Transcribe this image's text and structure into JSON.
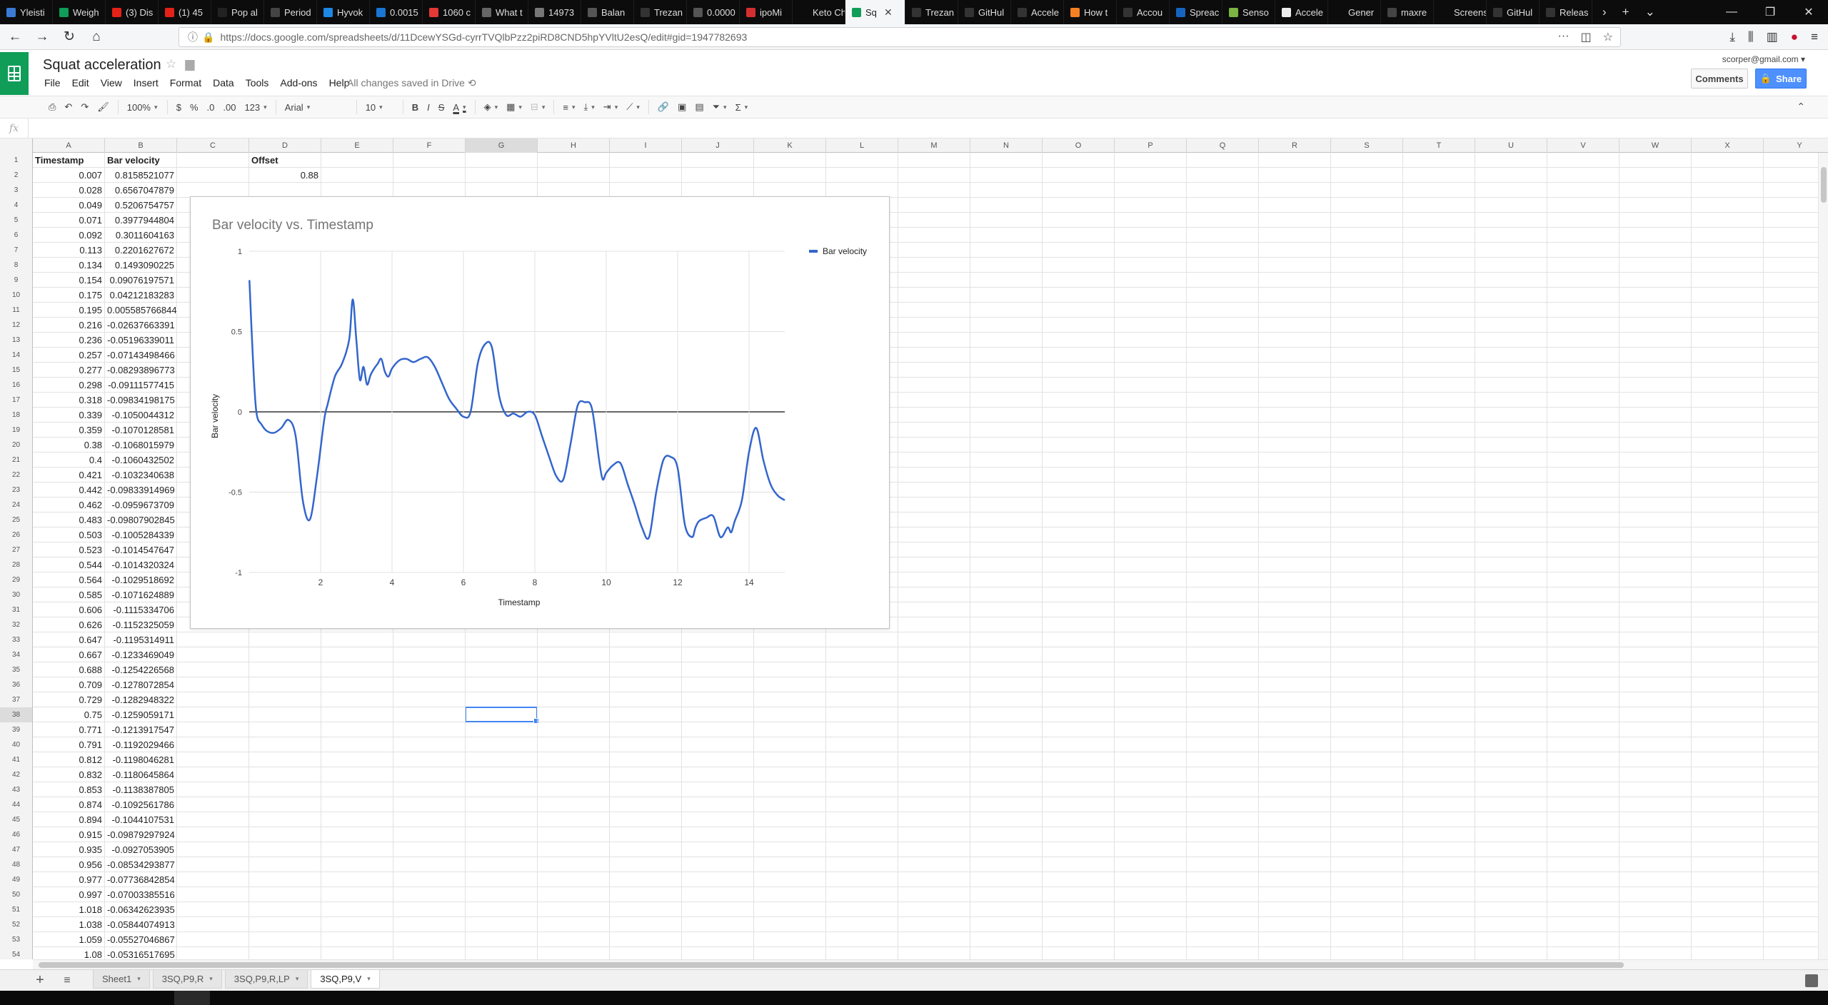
{
  "browser": {
    "tabs": [
      {
        "label": "Yleisti",
        "color": "#3a7bd5"
      },
      {
        "label": "Weigh",
        "color": "#0f9d58"
      },
      {
        "label": "(3) Dis",
        "color": "#e62117"
      },
      {
        "label": "(1) 45",
        "color": "#e62117"
      },
      {
        "label": "Pop al",
        "color": "#222222"
      },
      {
        "label": "Period",
        "color": "#444444"
      },
      {
        "label": "Hyvok",
        "color": "#1e88e5"
      },
      {
        "label": "0.0015",
        "color": "#1976d2"
      },
      {
        "label": "1060 c",
        "color": "#e53935"
      },
      {
        "label": "What t",
        "color": "#666666"
      },
      {
        "label": "14973",
        "color": "#777777"
      },
      {
        "label": "Balan",
        "color": "#555555"
      },
      {
        "label": "Trezan",
        "color": "#333333"
      },
      {
        "label": "0.0000",
        "color": "#555555"
      },
      {
        "label": "ipoMi",
        "color": "#d32f2f"
      },
      {
        "label": "Keto Choic",
        "color": "#0c0c0d"
      },
      {
        "label": "Sq",
        "color": "#0f9d58",
        "active": true
      },
      {
        "label": "Trezan",
        "color": "#333333"
      },
      {
        "label": "GitHul",
        "color": "#333333"
      },
      {
        "label": "Accele",
        "color": "#333333"
      },
      {
        "label": "How t",
        "color": "#f48024"
      },
      {
        "label": "Accou",
        "color": "#333333"
      },
      {
        "label": "Spreac",
        "color": "#1565c0"
      },
      {
        "label": "Senso",
        "color": "#7cb342"
      },
      {
        "label": "Accele",
        "color": "#eeeeee"
      },
      {
        "label": "Gener",
        "color": "#0c0c0d"
      },
      {
        "label": "maxre",
        "color": "#444444"
      },
      {
        "label": "Screenshot",
        "color": "#0c0c0d"
      },
      {
        "label": "GitHul",
        "color": "#333333"
      },
      {
        "label": "Releas",
        "color": "#333333"
      }
    ],
    "url": "https://docs.google.com/spreadsheets/d/11DcewYSGd-cyrrTVQlbPzz2piRD8CND5hpYVltU2esQ/edit#gid=1947782693"
  },
  "app": {
    "title": "Squat acceleration",
    "menus": [
      "File",
      "Edit",
      "View",
      "Insert",
      "Format",
      "Data",
      "Tools",
      "Add-ons",
      "Help"
    ],
    "save_status": "All changes saved in Drive",
    "user_email": "scorper@gmail.com",
    "comments_label": "Comments",
    "share_label": "Share"
  },
  "toolbar": {
    "zoom": "100%",
    "currency": "$",
    "percent": "%",
    "dec_less": ".0",
    "dec_more": ".00",
    "more_formats": "123",
    "font": "Arial",
    "font_size": "10",
    "bold": "B",
    "italic": "I",
    "strike": "S",
    "textcolor": "A",
    "sum": "Σ"
  },
  "formula": {
    "fx": "fx",
    "value": ""
  },
  "columns": [
    "A",
    "B",
    "C",
    "D",
    "E",
    "F",
    "G",
    "H",
    "I",
    "J",
    "K",
    "L",
    "M",
    "N",
    "O",
    "P",
    "Q",
    "R",
    "S",
    "T",
    "U",
    "V",
    "W",
    "X",
    "Y"
  ],
  "selected_column": "G",
  "selected_row": 38,
  "cells": {
    "a1": "Timestamp",
    "b1": "Bar velocity",
    "d1": "Offset",
    "d2": "0.88"
  },
  "data_rows": [
    [
      "0.007",
      "0.8158521077"
    ],
    [
      "0.028",
      "0.6567047879"
    ],
    [
      "0.049",
      "0.5206754757"
    ],
    [
      "0.071",
      "0.3977944804"
    ],
    [
      "0.092",
      "0.3011604163"
    ],
    [
      "0.113",
      "0.2201627672"
    ],
    [
      "0.134",
      "0.1493090225"
    ],
    [
      "0.154",
      "0.09076197571"
    ],
    [
      "0.175",
      "0.04212183283"
    ],
    [
      "0.195",
      "0.005585766844"
    ],
    [
      "0.216",
      "-0.02637663391"
    ],
    [
      "0.236",
      "-0.05196339011"
    ],
    [
      "0.257",
      "-0.07143498466"
    ],
    [
      "0.277",
      "-0.08293896773"
    ],
    [
      "0.298",
      "-0.09111577415"
    ],
    [
      "0.318",
      "-0.09834198175"
    ],
    [
      "0.339",
      "-0.1050044312"
    ],
    [
      "0.359",
      "-0.1070128581"
    ],
    [
      "0.38",
      "-0.1068015979"
    ],
    [
      "0.4",
      "-0.1060432502"
    ],
    [
      "0.421",
      "-0.1032340638"
    ],
    [
      "0.442",
      "-0.09833914969"
    ],
    [
      "0.462",
      "-0.0959673709"
    ],
    [
      "0.483",
      "-0.09807902845"
    ],
    [
      "0.503",
      "-0.1005284339"
    ],
    [
      "0.523",
      "-0.1014547647"
    ],
    [
      "0.544",
      "-0.1014320324"
    ],
    [
      "0.564",
      "-0.1029518692"
    ],
    [
      "0.585",
      "-0.1071624889"
    ],
    [
      "0.606",
      "-0.1115334706"
    ],
    [
      "0.626",
      "-0.1152325059"
    ],
    [
      "0.647",
      "-0.1195314911"
    ],
    [
      "0.667",
      "-0.1233469049"
    ],
    [
      "0.688",
      "-0.1254226568"
    ],
    [
      "0.709",
      "-0.1278072854"
    ],
    [
      "0.729",
      "-0.1282948322"
    ],
    [
      "0.75",
      "-0.1259059171"
    ],
    [
      "0.771",
      "-0.1213917547"
    ],
    [
      "0.791",
      "-0.1192029466"
    ],
    [
      "0.812",
      "-0.1198046281"
    ],
    [
      "0.832",
      "-0.1180645864"
    ],
    [
      "0.853",
      "-0.1138387805"
    ],
    [
      "0.874",
      "-0.1092561786"
    ],
    [
      "0.894",
      "-0.1044107531"
    ],
    [
      "0.915",
      "-0.09879297924"
    ],
    [
      "0.935",
      "-0.0927053905"
    ],
    [
      "0.956",
      "-0.08534293877"
    ],
    [
      "0.977",
      "-0.07736842854"
    ],
    [
      "0.997",
      "-0.07003385516"
    ],
    [
      "1.018",
      "-0.06342623935"
    ],
    [
      "1.038",
      "-0.05844074913"
    ],
    [
      "1.059",
      "-0.05527046867"
    ],
    [
      "1.08",
      "-0.05316517695"
    ]
  ],
  "chart_data": {
    "type": "line",
    "title": "Bar velocity vs. Timestamp",
    "xlabel": "Timestamp",
    "ylabel": "Bar velocity",
    "xlim": [
      0,
      15
    ],
    "ylim": [
      -1,
      1
    ],
    "x_ticks": [
      "2",
      "4",
      "6",
      "8",
      "10",
      "12",
      "14"
    ],
    "y_ticks": [
      "1",
      "0.5",
      "0",
      "-0.5",
      "-1"
    ],
    "grid": true,
    "legend": "right",
    "series": [
      {
        "name": "Bar velocity",
        "color": "#3366cc",
        "x": [
          0.007,
          0.1,
          0.2,
          0.35,
          0.5,
          0.7,
          0.9,
          1.1,
          1.3,
          1.5,
          1.7,
          1.9,
          2.1,
          2.2,
          2.4,
          2.6,
          2.8,
          2.9,
          3.0,
          3.1,
          3.2,
          3.3,
          3.4,
          3.5,
          3.6,
          3.7,
          3.8,
          3.9,
          4.0,
          4.2,
          4.4,
          4.6,
          4.8,
          5.0,
          5.2,
          5.4,
          5.6,
          5.8,
          6.0,
          6.2,
          6.4,
          6.6,
          6.8,
          7.0,
          7.2,
          7.4,
          7.6,
          7.8,
          8.0,
          8.2,
          8.4,
          8.6,
          8.8,
          9.0,
          9.2,
          9.4,
          9.6,
          9.8,
          9.9,
          10.0,
          10.2,
          10.4,
          10.6,
          10.8,
          11.0,
          11.2,
          11.4,
          11.6,
          11.8,
          12.0,
          12.2,
          12.4,
          12.5,
          12.6,
          12.8,
          13.0,
          13.2,
          13.4,
          13.5,
          13.6,
          13.8,
          14.0,
          14.2,
          14.4,
          14.6,
          14.8,
          15.0
        ],
        "y": [
          0.82,
          0.35,
          0.0,
          -0.08,
          -0.12,
          -0.13,
          -0.1,
          -0.05,
          -0.15,
          -0.55,
          -0.67,
          -0.4,
          -0.05,
          0.05,
          0.22,
          0.3,
          0.45,
          0.7,
          0.45,
          0.2,
          0.28,
          0.17,
          0.23,
          0.27,
          0.3,
          0.33,
          0.25,
          0.22,
          0.27,
          0.32,
          0.33,
          0.31,
          0.33,
          0.34,
          0.28,
          0.18,
          0.08,
          0.02,
          -0.03,
          0.0,
          0.3,
          0.42,
          0.4,
          0.1,
          -0.02,
          -0.01,
          -0.03,
          0.0,
          -0.02,
          -0.15,
          -0.28,
          -0.4,
          -0.42,
          -0.2,
          0.04,
          0.06,
          0.02,
          -0.3,
          -0.42,
          -0.38,
          -0.33,
          -0.32,
          -0.45,
          -0.58,
          -0.72,
          -0.78,
          -0.5,
          -0.3,
          -0.28,
          -0.35,
          -0.7,
          -0.78,
          -0.72,
          -0.68,
          -0.66,
          -0.65,
          -0.78,
          -0.72,
          -0.75,
          -0.68,
          -0.55,
          -0.25,
          -0.1,
          -0.3,
          -0.45,
          -0.52,
          -0.55
        ]
      }
    ]
  },
  "sheets": [
    {
      "label": "Sheet1",
      "active": false
    },
    {
      "label": "3SQ,P9,R",
      "active": false
    },
    {
      "label": "3SQ,P9,R,LP",
      "active": false
    },
    {
      "label": "3SQ,P9,V",
      "active": true
    }
  ]
}
